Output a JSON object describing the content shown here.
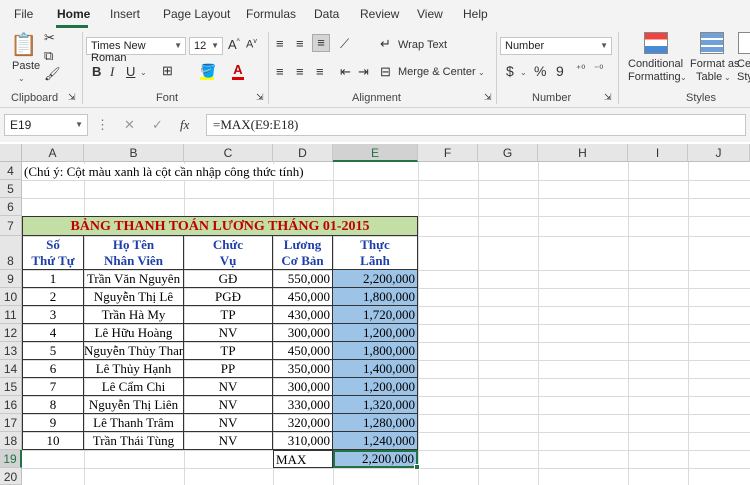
{
  "ribbon_tabs": [
    "File",
    "Home",
    "Insert",
    "Page Layout",
    "Formulas",
    "Data",
    "Review",
    "View",
    "Help"
  ],
  "clipboard": {
    "paste_label": "Paste",
    "group_label": "Clipboard"
  },
  "font": {
    "name": "Times New Roman",
    "size": "12",
    "group_label": "Font",
    "bold": "B",
    "italic": "I",
    "underline": "U"
  },
  "alignment": {
    "wrap_text": "Wrap Text",
    "merge_center": "Merge & Center",
    "group_label": "Alignment"
  },
  "number": {
    "format": "Number",
    "currency": "$",
    "percent": "%",
    "comma": "9",
    "group_label": "Number"
  },
  "styles": {
    "conditional": "Conditional",
    "formatting": "Formatting",
    "format_as": "Format as",
    "table": "Table",
    "cell_styles_1": "Ce",
    "cell_styles_2": "Sty",
    "group_label": "Styles"
  },
  "formula_bar": {
    "name_box": "E19",
    "formula": "=MAX(E9:E18)",
    "fx": "fx"
  },
  "columns": [
    "A",
    "B",
    "C",
    "D",
    "E",
    "F",
    "G",
    "H",
    "I",
    "J"
  ],
  "rows": [
    "4",
    "5",
    "6",
    "7",
    "8",
    "9",
    "10",
    "11",
    "12",
    "13",
    "14",
    "15",
    "16",
    "17",
    "18",
    "19",
    "20"
  ],
  "sheet": {
    "note": "(Chú ý: Cột màu xanh là cột cần nhập công thức tính)",
    "title": "BẢNG THANH TOÁN LƯƠNG THÁNG 01-2015",
    "headers": [
      {
        "line1": "Số",
        "line2": "Thứ Tự"
      },
      {
        "line1": "Họ Tên",
        "line2": "Nhân Viên"
      },
      {
        "line1": "Chức",
        "line2": "Vụ"
      },
      {
        "line1": "Lương",
        "line2": "Cơ Bản"
      },
      {
        "line1": "Thực",
        "line2": "Lãnh"
      }
    ],
    "data": [
      {
        "stt": "1",
        "name": "Trần Văn Nguyên",
        "role": "GĐ",
        "base": "550,000",
        "net": "2,200,000"
      },
      {
        "stt": "2",
        "name": "Nguyễn Thị Lê",
        "role": "PGĐ",
        "base": "450,000",
        "net": "1,800,000"
      },
      {
        "stt": "3",
        "name": "Trần Hà My",
        "role": "TP",
        "base": "430,000",
        "net": "1,720,000"
      },
      {
        "stt": "4",
        "name": "Lê Hữu Hoàng",
        "role": "NV",
        "base": "300,000",
        "net": "1,200,000"
      },
      {
        "stt": "5",
        "name": "Nguyễn Thủy Thanh",
        "role": "TP",
        "base": "450,000",
        "net": "1,800,000"
      },
      {
        "stt": "6",
        "name": "Lê Thủy Hạnh",
        "role": "PP",
        "base": "350,000",
        "net": "1,400,000"
      },
      {
        "stt": "7",
        "name": "Lê Cẩm Chi",
        "role": "NV",
        "base": "300,000",
        "net": "1,200,000"
      },
      {
        "stt": "8",
        "name": "Nguyễn Thị Liên",
        "role": "NV",
        "base": "330,000",
        "net": "1,320,000"
      },
      {
        "stt": "9",
        "name": "Lê Thanh Trâm",
        "role": "NV",
        "base": "320,000",
        "net": "1,280,000"
      },
      {
        "stt": "10",
        "name": "Trần Thái Tùng",
        "role": "NV",
        "base": "310,000",
        "net": "1,240,000"
      }
    ],
    "max_label": "MAX",
    "max_value": "2,200,000"
  },
  "colors": {
    "title_bg": "#c4dfa5",
    "net_bg": "#9dc3e6",
    "accent": "#217346"
  }
}
